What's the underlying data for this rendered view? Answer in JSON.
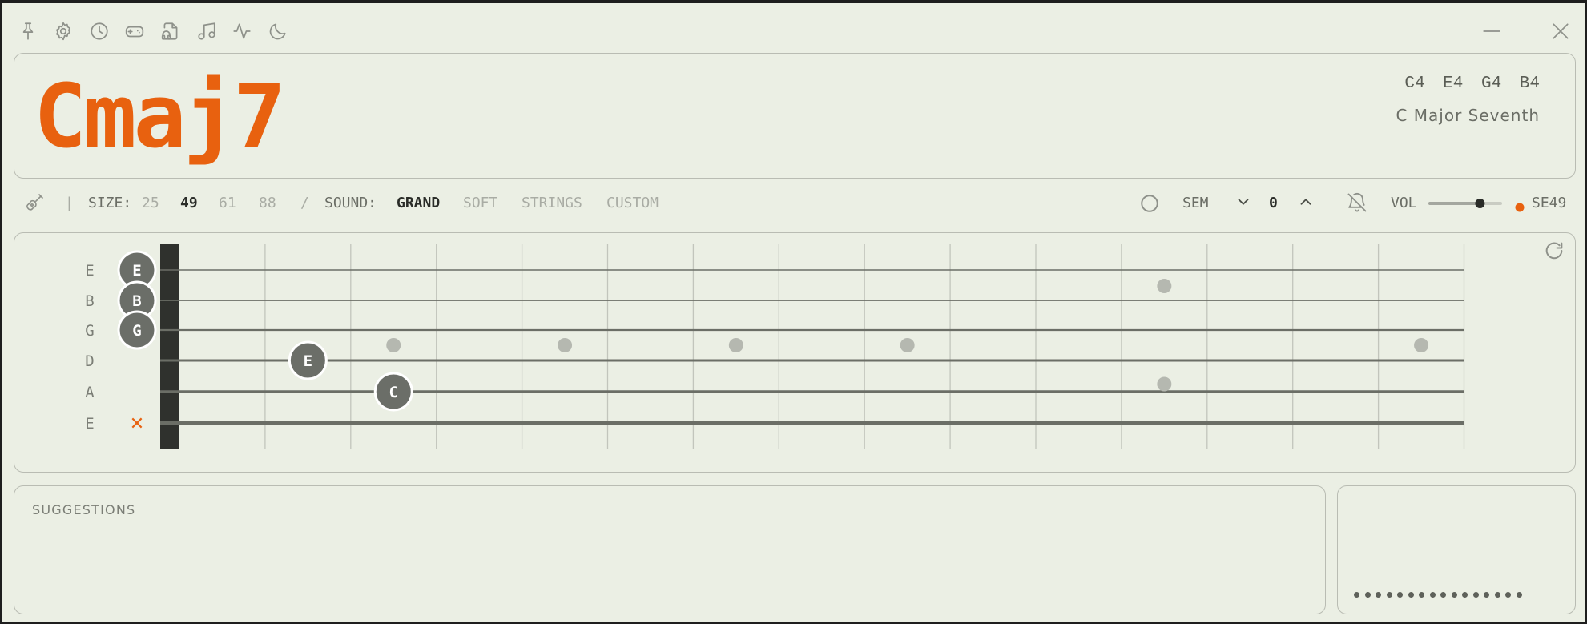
{
  "toolbar": {
    "icons": [
      "pin-icon",
      "gear-icon",
      "clock-icon",
      "gamepad-icon",
      "headphones-file-icon",
      "music-note-icon",
      "waveform-icon",
      "moon-icon"
    ],
    "window_controls": [
      "minimize-icon",
      "close-icon"
    ]
  },
  "chord": {
    "name": "Cmaj7",
    "notes": "C4  E4  G4  B4",
    "full_name": "C Major Seventh",
    "color": "#e8610f"
  },
  "controls": {
    "separator": "|",
    "size_label": "SIZE:",
    "sizes": [
      "25",
      "49",
      "61",
      "88"
    ],
    "size_selected": "49",
    "slash": "/",
    "sound_label": "SOUND:",
    "sounds": [
      "GRAND",
      "SOFT",
      "STRINGS",
      "CUSTOM"
    ],
    "sound_selected": "GRAND",
    "sem_label": "SEM",
    "sem_value": "0",
    "vol_label": "VOL",
    "volume_level": 0.7,
    "device_status_color": "#e8610f",
    "device": "SE49"
  },
  "fretboard": {
    "strings": [
      "E",
      "B",
      "G",
      "D",
      "A",
      "E"
    ],
    "frets": 15,
    "open_notes": [
      {
        "string": 0,
        "label": "E"
      },
      {
        "string": 1,
        "label": "B"
      },
      {
        "string": 2,
        "label": "G"
      }
    ],
    "fretted_notes": [
      {
        "string": 3,
        "fret": 2,
        "label": "E"
      },
      {
        "string": 4,
        "fret": 3,
        "label": "C"
      }
    ],
    "muted_strings": [
      5
    ],
    "muted_symbol": "✕",
    "inlay_frets": [
      3,
      5,
      7,
      9,
      15
    ],
    "double_inlay_fret": 12
  },
  "suggestions": {
    "title": "SUGGESTIONS"
  },
  "side_panel": {
    "dot_count": 16
  }
}
